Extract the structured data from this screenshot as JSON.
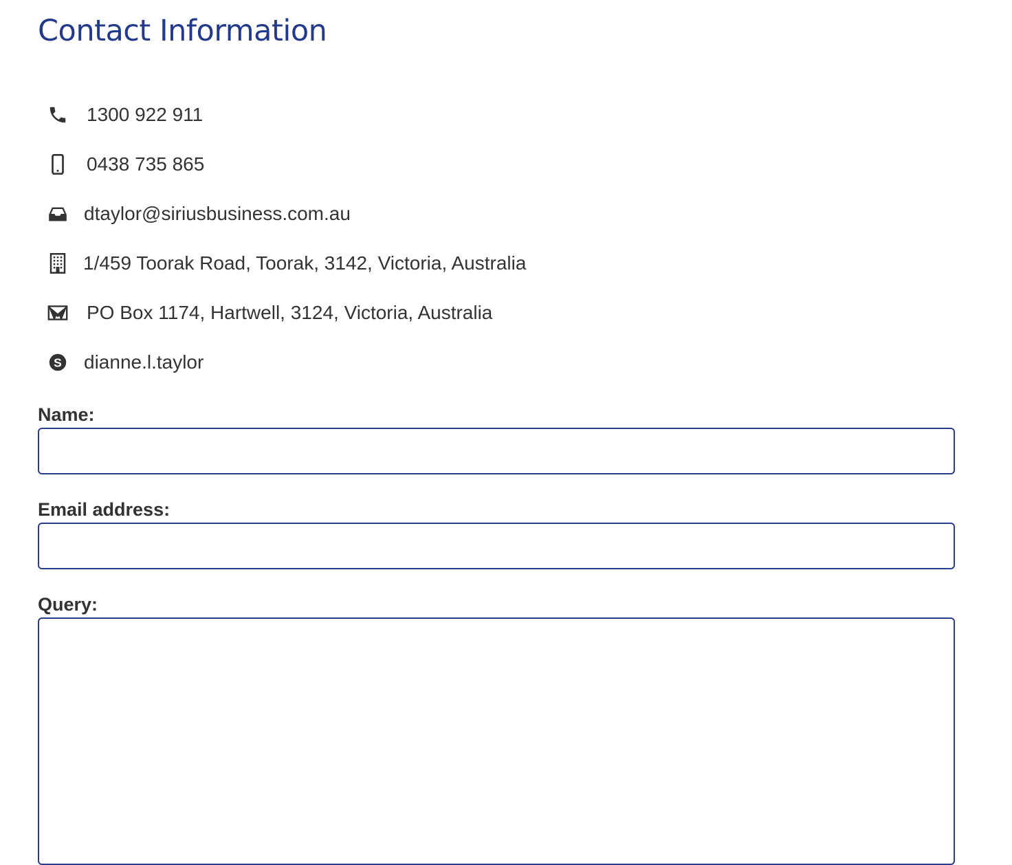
{
  "page": {
    "title": "Contact Information"
  },
  "colors": {
    "title": "#233a8b",
    "field_border": "#2b3c8c",
    "text": "#333333",
    "icon": "#333333"
  },
  "contacts": [
    {
      "icon": "phone-icon",
      "text": "1300 922 911"
    },
    {
      "icon": "mobile-phone-icon",
      "text": "0438 735 865"
    },
    {
      "icon": "inbox-icon",
      "text": "dtaylor@siriusbusiness.com.au"
    },
    {
      "icon": "building-icon",
      "text": "1/459 Toorak Road, Toorak, 3142, Victoria, Australia"
    },
    {
      "icon": "envelope-icon",
      "text": "PO Box 1174, Hartwell, 3124, Victoria, Australia"
    },
    {
      "icon": "skype-icon",
      "text": "dianne.l.taylor"
    }
  ],
  "form": {
    "name_label": "Name:",
    "name_value": "",
    "email_label": "Email address:",
    "email_value": "",
    "query_label": "Query:",
    "query_value": ""
  }
}
